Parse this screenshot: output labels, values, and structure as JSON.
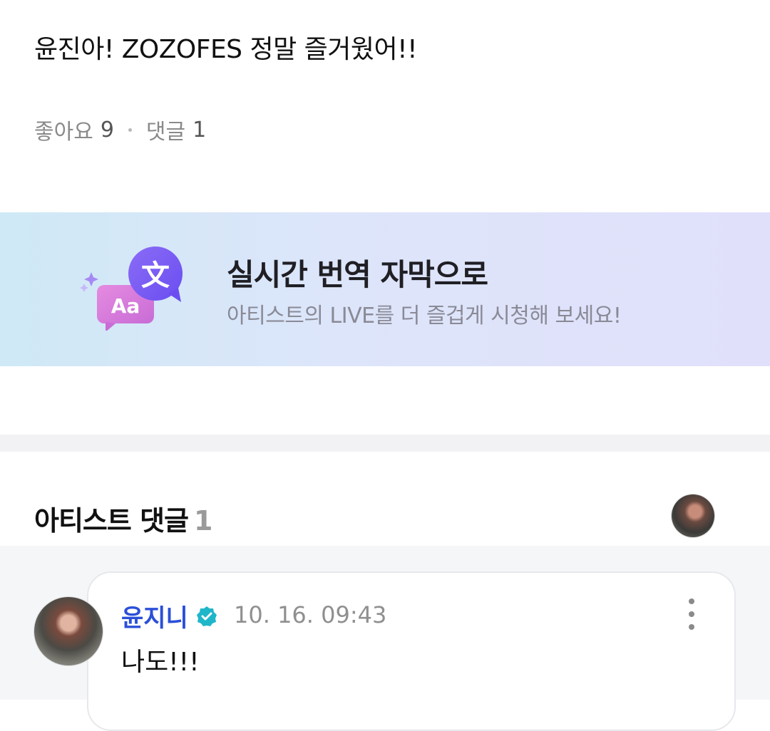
{
  "post": {
    "text": "윤진아! ZOZOFES 정말 즐거웠어!!",
    "likes_label": "좋아요",
    "likes_count": "9",
    "comments_label": "댓글",
    "comments_count": "1"
  },
  "banner": {
    "title": "실시간 번역 자막으로",
    "subtitle": "아티스트의 LIVE를 더 즐겁게 시청해 보세요!",
    "icon_glyph_translated": "文",
    "icon_glyph_source": "Aa"
  },
  "artist_comments": {
    "title": "아티스트 댓글",
    "count": "1"
  },
  "comment": {
    "author": "윤지니",
    "time": "10. 16. 09:43",
    "text": "나도!!!"
  },
  "colors": {
    "author_blue": "#2b4fd8",
    "verified_teal": "#1fb6c9",
    "banner_purple": "#8b5cf6",
    "banner_pink": "#d97ad6"
  }
}
